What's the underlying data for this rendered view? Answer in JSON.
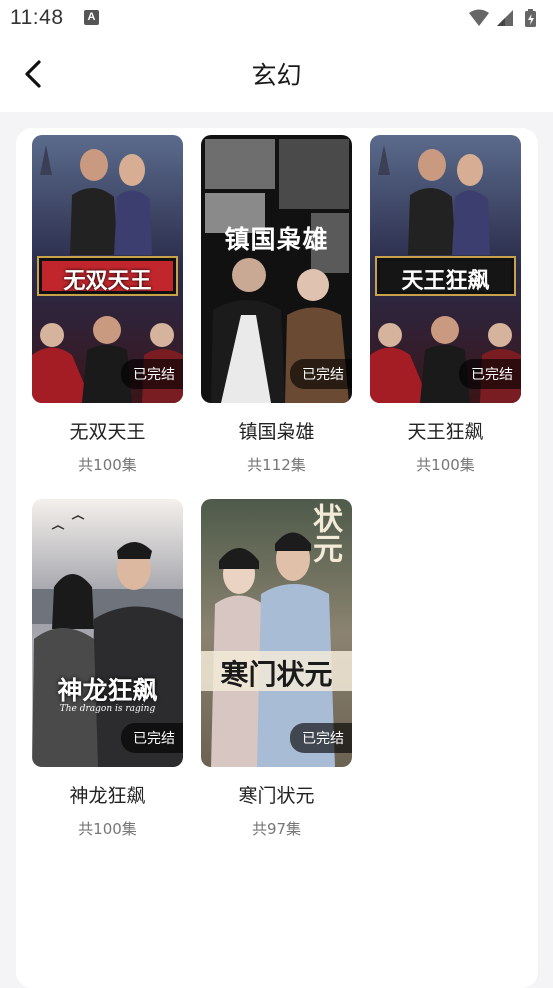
{
  "status_bar": {
    "time": "11:48",
    "notification_icon": "A",
    "icons": [
      "wifi-icon",
      "signal-icon",
      "battery-icon"
    ]
  },
  "header": {
    "title": "玄幻",
    "back_icon": "chevron-left-icon"
  },
  "dramas": [
    {
      "name": "无双天王",
      "count": "共100集",
      "badge": "已完结",
      "poster_title": "无双天王",
      "theme": "#2a2b4a",
      "accent": "#c0262c"
    },
    {
      "name": "镇国枭雄",
      "count": "共112集",
      "badge": "已完结",
      "poster_title": "镇国枭雄",
      "theme": "#1c1c1c",
      "accent": "#8a8a8a"
    },
    {
      "name": "天王狂飙",
      "count": "共100集",
      "badge": "已完结",
      "poster_title": "天王狂飙",
      "theme": "#2a2b4a",
      "accent": "#c0262c"
    },
    {
      "name": "神龙狂飙",
      "count": "共100集",
      "badge": "已完结",
      "poster_title": "神龙狂飙",
      "poster_subtitle": "The dragon is raging",
      "theme": "#8a8d96",
      "accent": "#2b2b2b"
    },
    {
      "name": "寒门状元",
      "count": "共97集",
      "badge": "已完结",
      "poster_title": "寒门状元",
      "poster_subtitle": "状元",
      "theme": "#7b7565",
      "accent": "#9fb3cf"
    }
  ],
  "colors": {
    "page_bg": "#f4f4f6",
    "card_bg": "#ffffff",
    "title_text": "#1a1a1a",
    "count_text": "#777777"
  }
}
